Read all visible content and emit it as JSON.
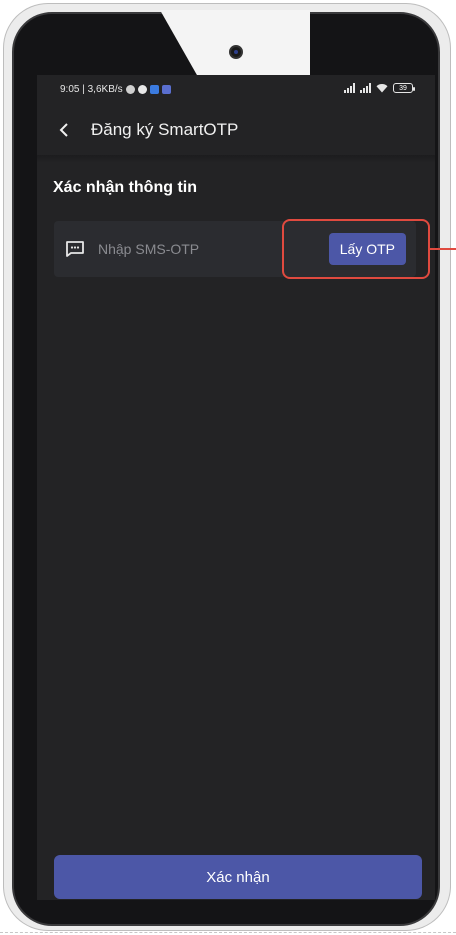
{
  "status_bar": {
    "time_speed": "9:05 | 3,6KB/s",
    "battery_level": "39"
  },
  "header": {
    "title": "Đăng ký SmartOTP",
    "back_icon": "chevron-left-icon"
  },
  "section": {
    "title": "Xác nhận thông tin"
  },
  "otp_field": {
    "icon": "sms-icon",
    "placeholder": "Nhập SMS-OTP",
    "value": "",
    "get_otp_label": "Lấy OTP"
  },
  "footer": {
    "confirm_label": "Xác nhận"
  },
  "colors": {
    "accent": "#4c57a7",
    "background": "#232325",
    "highlight": "#e04a3f"
  }
}
